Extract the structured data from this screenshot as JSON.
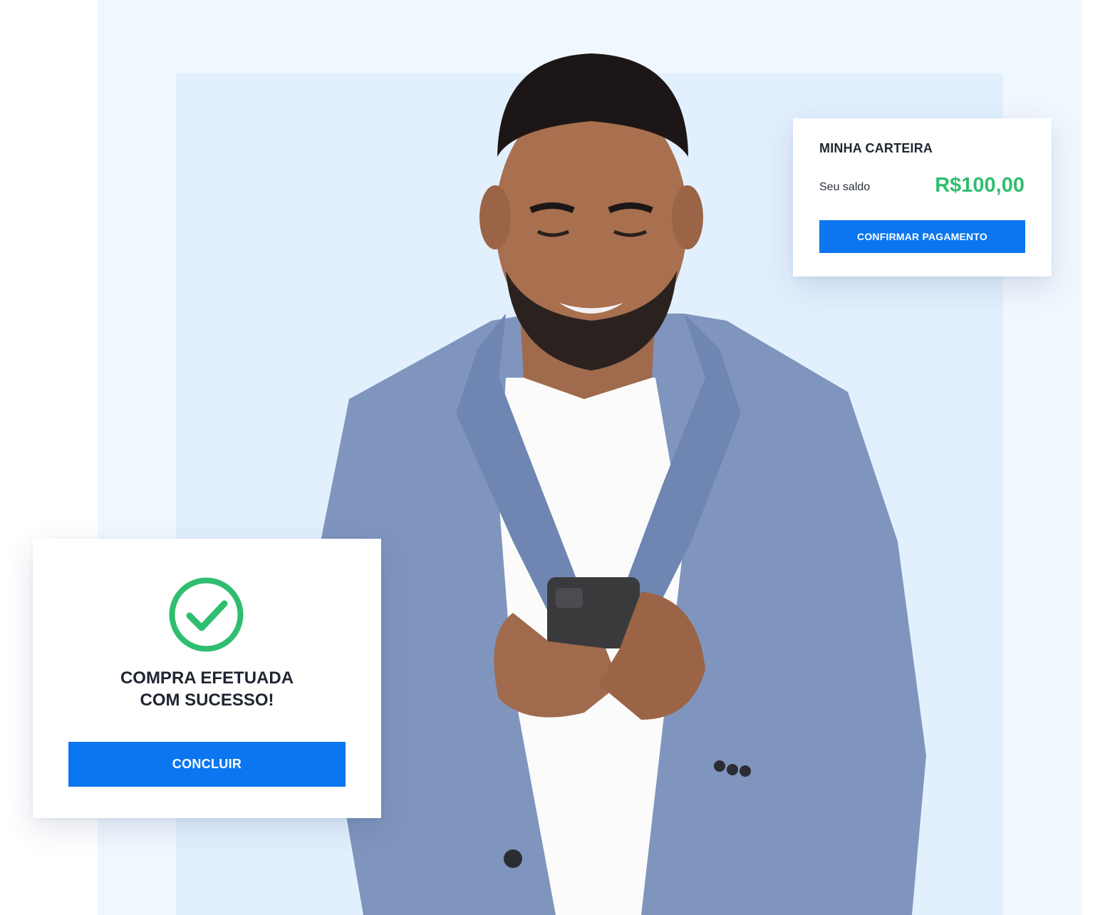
{
  "colors": {
    "accent": "#0b76ef",
    "success": "#2fbe6f",
    "bg_outer": "#f1f7fe",
    "bg_inner": "#e2f0fd",
    "text_dark": "#1f2530"
  },
  "photo": {
    "icon": "person-holding-phone-photo"
  },
  "wallet": {
    "title": "MINHA CARTEIRA",
    "balance_label": "Seu saldo",
    "balance_value": "R$100,00",
    "confirm_label": "CONFIRMAR PAGAMENTO"
  },
  "success": {
    "icon": "check-circle-icon",
    "line1": "COMPRA EFETUADA",
    "line2": "COM SUCESSO!",
    "button_label": "CONCLUIR"
  }
}
